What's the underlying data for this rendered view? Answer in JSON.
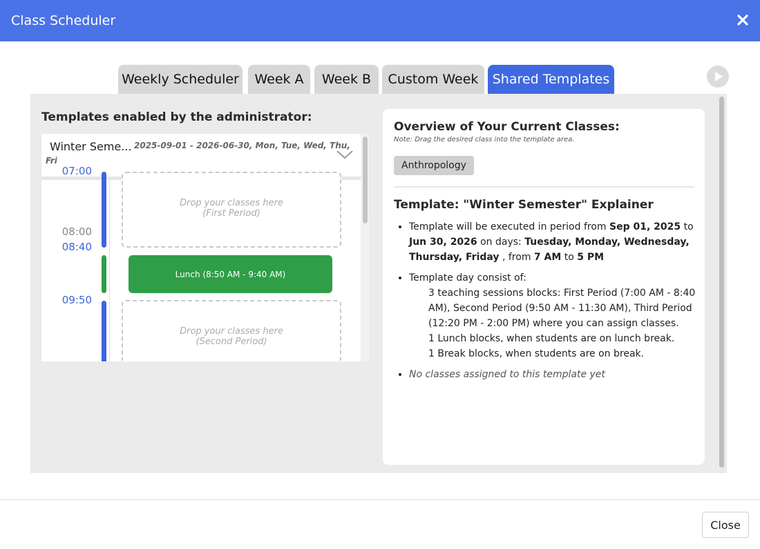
{
  "window": {
    "title": "Class Scheduler",
    "close_icon": "close-icon"
  },
  "tabs": [
    {
      "label": "Weekly Scheduler",
      "active": false
    },
    {
      "label": "Week A",
      "active": false
    },
    {
      "label": "Week B",
      "active": false
    },
    {
      "label": "Custom Week",
      "active": false
    },
    {
      "label": "Shared Templates",
      "active": true
    }
  ],
  "colors": {
    "header": "#4a73e8",
    "active_tab": "#3f69e1",
    "period_bar": "#3c66dd",
    "lunch": "#2f9e47"
  },
  "left": {
    "heading": "Templates enabled by the administrator:",
    "template": {
      "name": "Winter Seme...",
      "dates": "2025-09-01 - 2026-06-30, Mon, Tue, Wed, Thu,",
      "dates_wrap": "Fri"
    },
    "times": {
      "t0700": "07:00",
      "t0800": "08:00",
      "t0840": "08:40",
      "t0950": "09:50"
    },
    "drop_text": "Drop your classes here",
    "first_period": "(First Period)",
    "second_period": "(Second Period)",
    "lunch": "Lunch (8:50 AM - 9:40 AM)"
  },
  "right": {
    "overview_title": "Overview of Your Current Classes:",
    "overview_note": "Note: Drag the desired class into the template area.",
    "classes": [
      "Anthropology"
    ],
    "explainer_title": "Template: \"Winter Semester\" Explainer",
    "exec": {
      "pre": "Template will be executed in period from ",
      "start": "Sep 01, 2025",
      "to": " to ",
      "end": "Jun 30, 2026",
      "days_label": " on days: ",
      "days": "Tuesday, Monday, Wednesday, Thursday, Friday",
      "from": " , from ",
      "start_time": "7 AM",
      "to2": " to ",
      "end_time": "5 PM"
    },
    "day_consist": {
      "label": "Template day consist of:",
      "teaching": "3 teaching sessions blocks: First Period (7:00 AM - 8:40 AM), Second Period (9:50 AM - 11:30 AM), Third Period (12:20 PM - 2:00 PM) where you can assign classes.",
      "lunch": "1 Lunch blocks, when students are on lunch break.",
      "break": "1 Break blocks, when students are on break."
    },
    "empty": "No classes assigned to this template yet"
  },
  "footer": {
    "close_label": "Close"
  }
}
